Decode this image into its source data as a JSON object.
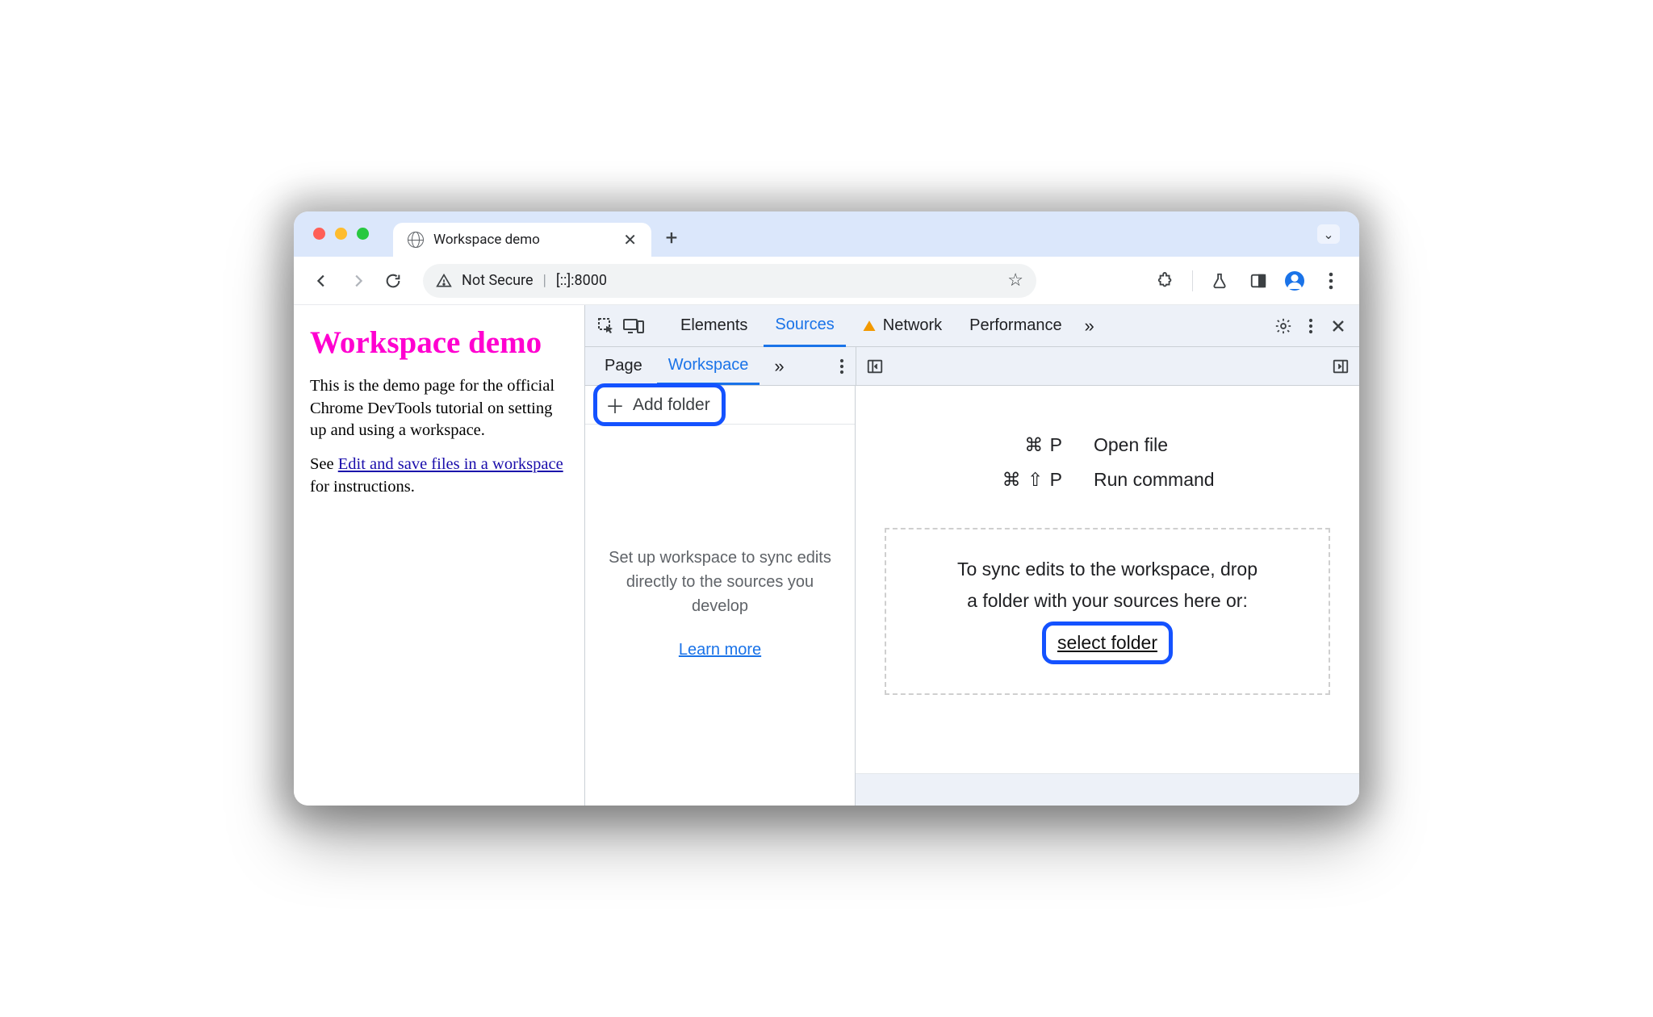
{
  "browser": {
    "tab_title": "Workspace demo",
    "address_security": "Not Secure",
    "address_url": "[::]:8000"
  },
  "page": {
    "heading": "Workspace demo",
    "para1": "This is the demo page for the official Chrome DevTools tutorial on setting up and using a workspace.",
    "para2_prefix": "See ",
    "para2_link": "Edit and save files in a workspace",
    "para2_suffix": " for instructions."
  },
  "devtools": {
    "top_tabs": {
      "elements": "Elements",
      "sources": "Sources",
      "network": "Network",
      "performance": "Performance"
    },
    "sub_tabs": {
      "page": "Page",
      "workspace": "Workspace"
    },
    "add_folder": "Add folder",
    "navigator_hint": "Set up workspace to sync edits directly to the sources you develop",
    "learn_more": "Learn more",
    "shortcuts": {
      "open_file_keys": "⌘ P",
      "open_file_label": "Open file",
      "run_cmd_keys": "⌘ ⇧ P",
      "run_cmd_label": "Run command"
    },
    "dropzone_line1": "To sync edits to the workspace, drop",
    "dropzone_line2": "a folder with your sources here or:",
    "select_folder": "select folder"
  }
}
